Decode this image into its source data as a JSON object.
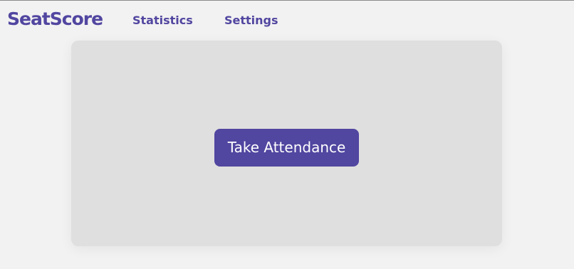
{
  "header": {
    "logo_text": "SeatScore",
    "nav": [
      {
        "label": "Statistics"
      },
      {
        "label": "Settings"
      }
    ]
  },
  "main": {
    "action_button_label": "Take Attendance"
  },
  "colors": {
    "brand": "#5146a0",
    "page_background": "#f2f2f2",
    "card_background": "#dfdfdf",
    "button_text": "#ffffff"
  }
}
